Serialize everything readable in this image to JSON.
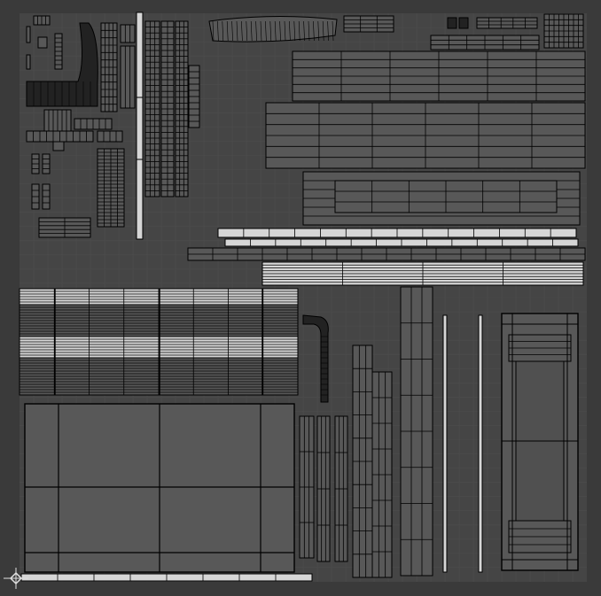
{
  "editor": {
    "mode": "uv-editor",
    "colors": {
      "background": "#3a3a3a",
      "tile": "#454545",
      "grid": "#4d4d4d",
      "island_fill": "#585858",
      "island_light": "#d6d6d6",
      "edge": "#000000",
      "gizmo": "#e0e0e0"
    },
    "icons": [
      "uv-origin-gizmo-icon"
    ]
  }
}
